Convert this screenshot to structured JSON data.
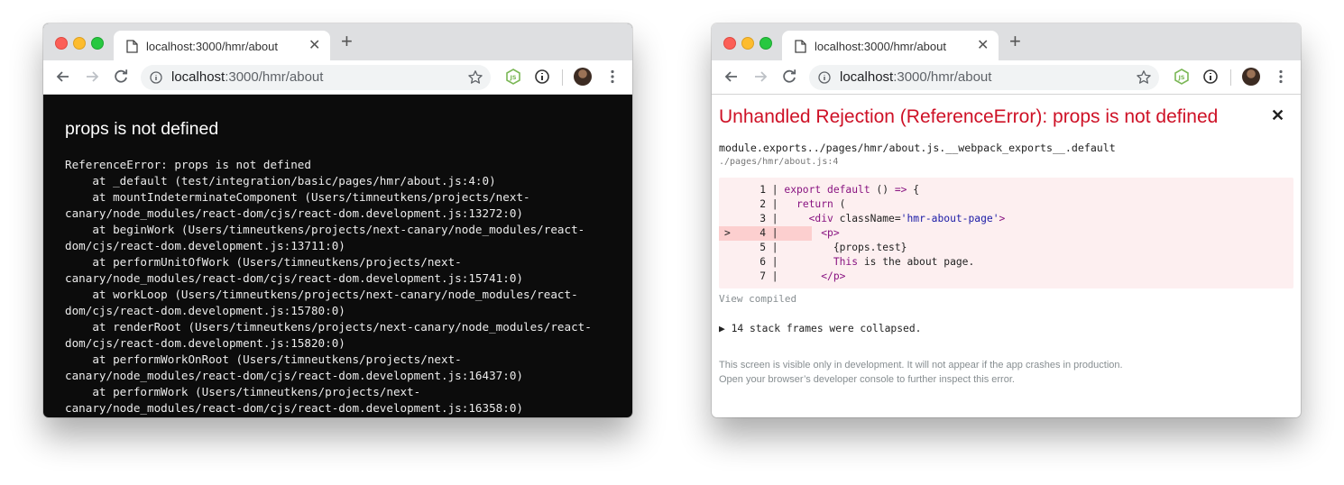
{
  "windows": [
    {
      "tab_title": "localhost:3000/hmr/about",
      "url_host": "localhost",
      "url_rest": ":3000/hmr/about",
      "error_title": "props is not defined",
      "stack_text": "ReferenceError: props is not defined\n    at _default (test/integration/basic/pages/hmr/about.js:4:0)\n    at mountIndeterminateComponent (Users/timneutkens/projects/next-\ncanary/node_modules/react-dom/cjs/react-dom.development.js:13272:0)\n    at beginWork (Users/timneutkens/projects/next-canary/node_modules/react-\ndom/cjs/react-dom.development.js:13711:0)\n    at performUnitOfWork (Users/timneutkens/projects/next-\ncanary/node_modules/react-dom/cjs/react-dom.development.js:15741:0)\n    at workLoop (Users/timneutkens/projects/next-canary/node_modules/react-\ndom/cjs/react-dom.development.js:15780:0)\n    at renderRoot (Users/timneutkens/projects/next-canary/node_modules/react-\ndom/cjs/react-dom.development.js:15820:0)\n    at performWorkOnRoot (Users/timneutkens/projects/next-\ncanary/node_modules/react-dom/cjs/react-dom.development.js:16437:0)\n    at performWork (Users/timneutkens/projects/next-\ncanary/node_modules/react-dom/cjs/react-dom.development.js:16358:0)"
    },
    {
      "tab_title": "localhost:3000/hmr/about",
      "url_host": "localhost",
      "url_rest": ":3000/hmr/about",
      "error_title": "Unhandled Rejection (ReferenceError): props is not defined",
      "close_glyph": "✕",
      "frame_function": "module.exports../pages/hmr/about.js.__webpack_exports__.default",
      "frame_file": "./pages/hmr/about.js:4",
      "code_lines": [
        {
          "marker": "  ",
          "num": "1",
          "parts": [
            {
              "t": "export default",
              "c": "kw"
            },
            {
              "t": " () ",
              "c": ""
            },
            {
              "t": "=>",
              "c": "kw"
            },
            {
              "t": " {",
              "c": ""
            }
          ]
        },
        {
          "marker": "  ",
          "num": "2",
          "parts": [
            {
              "t": "  ",
              "c": ""
            },
            {
              "t": "return",
              "c": "kw"
            },
            {
              "t": " (",
              "c": ""
            }
          ]
        },
        {
          "marker": "  ",
          "num": "3",
          "parts": [
            {
              "t": "    ",
              "c": ""
            },
            {
              "t": "<div",
              "c": "tag"
            },
            {
              "t": " className=",
              "c": ""
            },
            {
              "t": "'hmr-about-page'",
              "c": "str"
            },
            {
              "t": ">",
              "c": "tag"
            }
          ]
        },
        {
          "marker": "> ",
          "num": "4",
          "parts": [
            {
              "t": "      ",
              "c": ""
            },
            {
              "t": "<p>",
              "c": "tag"
            }
          ]
        },
        {
          "marker": "  ",
          "num": "5",
          "parts": [
            {
              "t": "        {props.test}",
              "c": ""
            }
          ]
        },
        {
          "marker": "  ",
          "num": "6",
          "parts": [
            {
              "t": "        ",
              "c": ""
            },
            {
              "t": "This",
              "c": "kw"
            },
            {
              "t": " is the about page.",
              "c": ""
            }
          ]
        },
        {
          "marker": "  ",
          "num": "7",
          "parts": [
            {
              "t": "      ",
              "c": ""
            },
            {
              "t": "</p>",
              "c": "tag"
            }
          ]
        }
      ],
      "view_compiled": "View compiled",
      "collapsed_text": "▶ 14 stack frames were collapsed.",
      "note_line_1": "This screen is visible only in development. It will not appear if the app crashes in production.",
      "note_line_2": "Open your browser’s developer console to further inspect this error."
    }
  ],
  "icons": {
    "back": "arrow-left-icon",
    "forward": "arrow-right-icon",
    "reload": "reload-icon",
    "info": "info-icon",
    "bookmark": "star-icon",
    "extension_node": "nodejs-extension-icon",
    "extension_info": "info-extension-icon",
    "profile": "avatar",
    "menu": "kebab-menu-icon"
  },
  "colors": {
    "error_red": "#ce1126",
    "terminal_bg": "#0c0c0c",
    "code_highlight_bg": "#fdeff0",
    "keyword": "#881280",
    "string": "#1a1aa6"
  }
}
